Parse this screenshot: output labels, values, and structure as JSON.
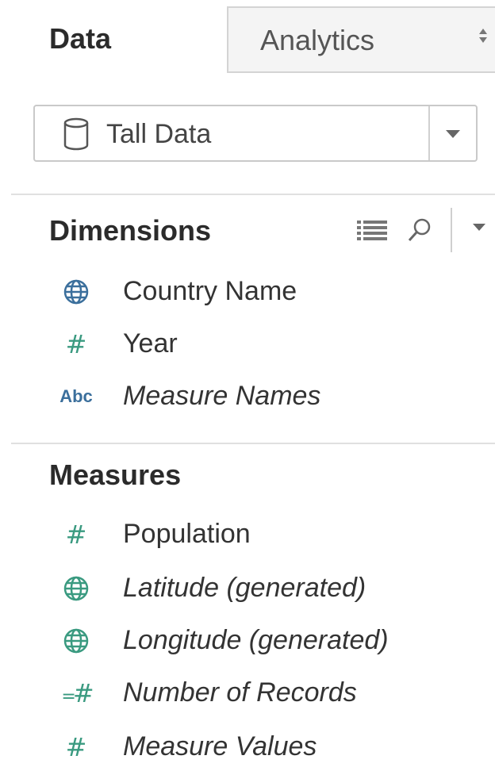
{
  "tabs": {
    "data_label": "Data",
    "analytics_label": "Analytics",
    "sort_glyph": "⇕"
  },
  "data_source": {
    "label": "Tall Data",
    "icon": "database-icon"
  },
  "dimensions": {
    "title": "Dimensions",
    "toolbar": [
      "view-list-icon",
      "search-icon",
      "dropdown-arrow-icon"
    ],
    "fields": [
      {
        "name": "Country Name",
        "icon": "globe-icon",
        "italic": false
      },
      {
        "name": "Year",
        "icon": "number-icon",
        "italic": false
      },
      {
        "name": "Measure Names",
        "icon": "abc-icon",
        "icon_text": "Abc",
        "italic": true
      }
    ]
  },
  "measures": {
    "title": "Measures",
    "fields": [
      {
        "name": "Population",
        "icon": "number-icon",
        "italic": false
      },
      {
        "name": "Latitude (generated)",
        "icon": "globe-icon",
        "italic": true
      },
      {
        "name": "Longitude (generated)",
        "icon": "globe-icon",
        "italic": true
      },
      {
        "name": "Number of Records",
        "icon": "calculated-number-icon",
        "italic": true
      },
      {
        "name": "Measure Values",
        "icon": "number-icon",
        "italic": true
      }
    ]
  },
  "colors": {
    "dimension_icon": "#3b6f9c",
    "measure_icon": "#3a9a80"
  }
}
